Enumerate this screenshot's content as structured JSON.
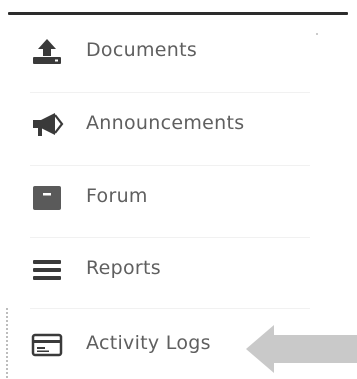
{
  "menu": {
    "items": [
      {
        "label": "Documents",
        "icon": "upload-tray-icon"
      },
      {
        "label": "Announcements",
        "icon": "megaphone-icon"
      },
      {
        "label": "Forum",
        "icon": "archive-box-icon"
      },
      {
        "label": "Reports",
        "icon": "list-lines-icon"
      },
      {
        "label": "Activity Logs",
        "icon": "credit-card-icon"
      }
    ]
  },
  "colors": {
    "icon": "#3a3a3a",
    "label": "#5f5f5f",
    "arrow": "#c9c9c9",
    "rule": "#2c2c2c"
  },
  "pointer": {
    "icon": "arrow-left-icon"
  }
}
